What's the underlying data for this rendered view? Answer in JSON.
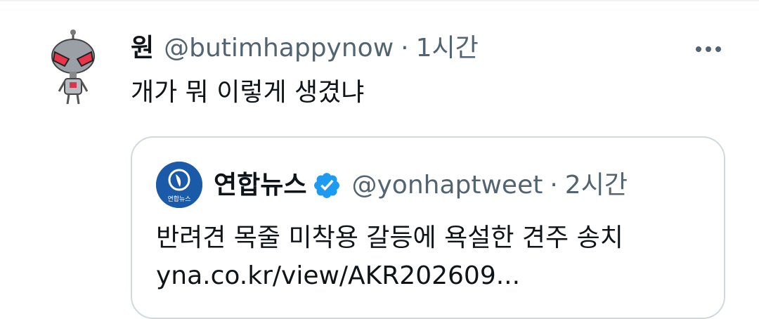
{
  "tweet": {
    "display_name": "원",
    "handle": "@butimhappynow",
    "separator": "·",
    "time": "1시간",
    "text": "개가 뭐 이렇게 생겼냐",
    "avatar_icon": "invader-zim-gir-avatar-icon",
    "more_icon": "more-options-icon"
  },
  "quote": {
    "display_name": "연합뉴스",
    "handle": "@yonhaptweet",
    "separator": "·",
    "time": "2시간",
    "text": "반려견 목줄 미착용 갈등에 욕설한 견주 송치",
    "link": "yna.co.kr/view/AKR202609...",
    "verified_icon": "verified-badge-icon",
    "logo_text": "연합뉴스"
  },
  "colors": {
    "text_primary": "#0f1419",
    "text_secondary": "#536471",
    "border": "#cfd9de",
    "verified": "#1d9bf0",
    "logo_bg": "#1a5aa8"
  }
}
